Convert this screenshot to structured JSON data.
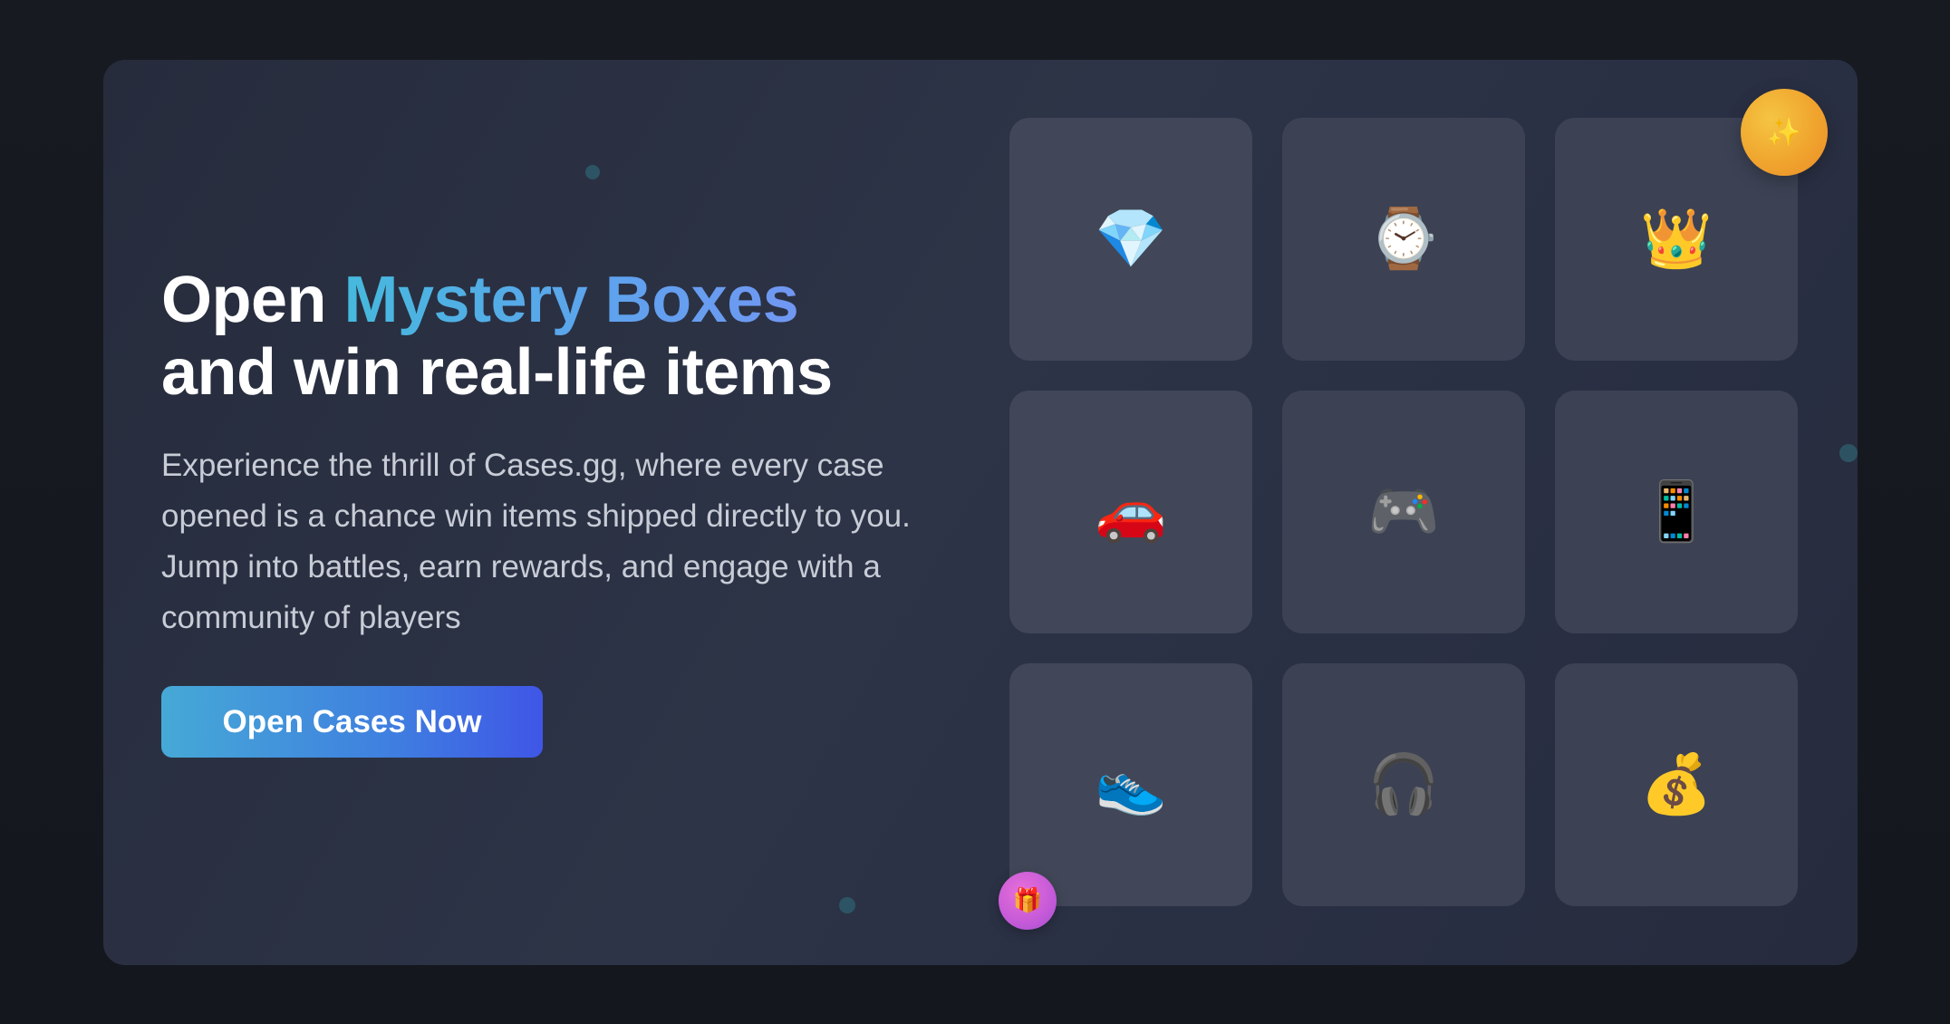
{
  "hero": {
    "headline_prefix": "Open ",
    "headline_accent": "Mystery Boxes",
    "headline_line2": "and win real-life items",
    "description": "Experience the thrill of Cases.gg, where every case opened is a chance win items shipped directly to you. Jump into battles, earn rewards, and engage with a community of players",
    "cta_label": "Open Cases Now"
  },
  "items": [
    {
      "icon": "gem-icon",
      "emoji": "💎"
    },
    {
      "icon": "watch-icon",
      "emoji": "⌚"
    },
    {
      "icon": "crown-icon",
      "emoji": "👑"
    },
    {
      "icon": "car-icon",
      "emoji": "🚗"
    },
    {
      "icon": "gamepad-icon",
      "emoji": "🎮"
    },
    {
      "icon": "phone-icon",
      "emoji": "📱"
    },
    {
      "icon": "sneaker-icon",
      "emoji": "👟"
    },
    {
      "icon": "headphones-icon",
      "emoji": "🎧"
    },
    {
      "icon": "money-bag-icon",
      "emoji": "💰"
    }
  ],
  "badges": {
    "sparkle": {
      "icon": "sparkles-icon",
      "emoji": "✨"
    },
    "gift": {
      "icon": "gift-icon",
      "emoji": "🎁"
    }
  },
  "colors": {
    "background": "#15181f",
    "card": "#2d3447",
    "tile": "#414758",
    "accent_start": "#46b9dd",
    "accent_end": "#7197f2",
    "button_start": "#46a9d6",
    "button_end": "#3f56e6"
  }
}
